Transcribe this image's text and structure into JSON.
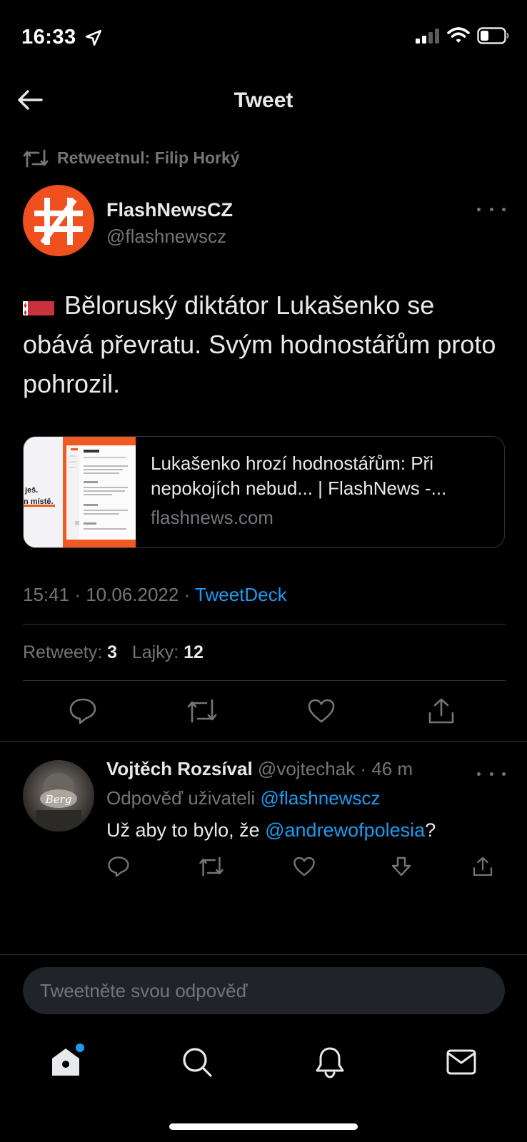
{
  "status_bar": {
    "time": "16:33"
  },
  "header": {
    "title": "Tweet"
  },
  "retweet": {
    "label": "Retweetnul: Filip Horký"
  },
  "author": {
    "name": "FlashNewsCZ",
    "handle": "@flashnewscz"
  },
  "tweet": {
    "text": "Běloruský diktátor Lukašenko se obává převratu. Svým hodnostářům proto pohrozil.",
    "flag": "Belarus"
  },
  "link_card": {
    "title": "Lukašenko hrozí hodnostářům: Při nepokojích nebud... | FlashNews -...",
    "domain": "flashnews.com",
    "thumb_lines": [
      "ješ.",
      "n místě."
    ]
  },
  "meta": {
    "time": "15:41",
    "date": "10.06.2022",
    "client": "TweetDeck",
    "sep": "·"
  },
  "stats": {
    "retweets_label": "Retweety:",
    "retweets": "3",
    "likes_label": "Lajky:",
    "likes": "12"
  },
  "reply": {
    "name": "Vojtěch Rozsíval",
    "handle": "@vojtechak",
    "age": "· 46 m",
    "reply_to_label": "Odpověď uživateli",
    "reply_to": "@flashnewscz",
    "text_before": "Už aby to bylo, že ",
    "mention": "@andrewofpolesia",
    "text_after": "?"
  },
  "compose": {
    "placeholder": "Tweetněte svou odpověď"
  },
  "colors": {
    "accent": "#1d9bf0",
    "background": "#000000",
    "muted": "#71767b",
    "avatar_brand": "#f0501e"
  }
}
